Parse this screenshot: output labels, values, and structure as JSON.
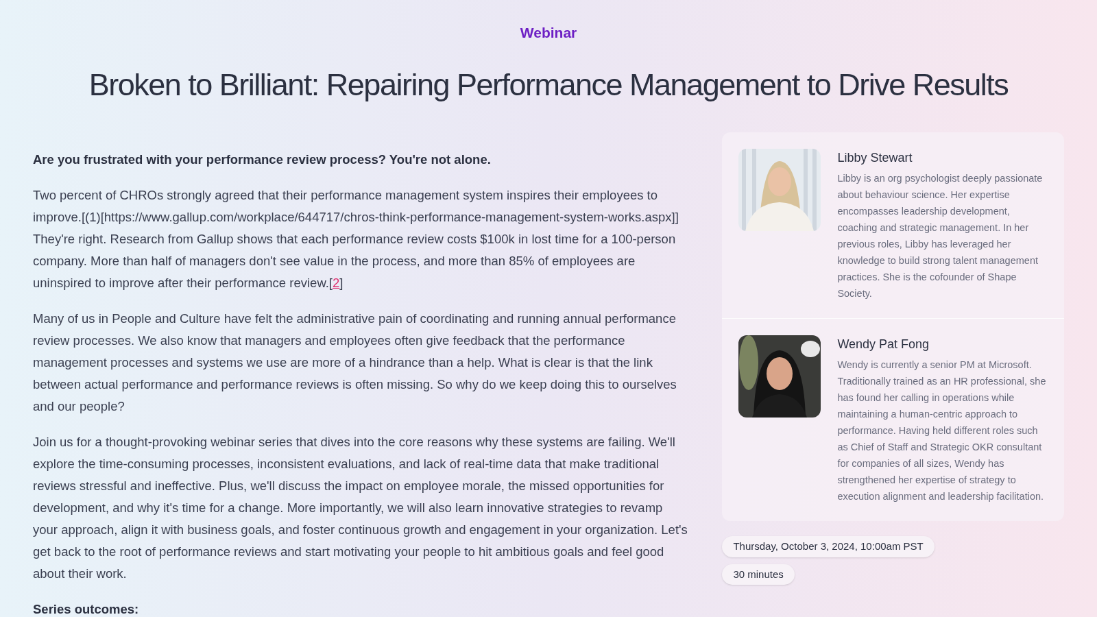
{
  "eyebrow": "Webinar",
  "title": "Broken to Brilliant: Repairing Performance Management to Drive Results",
  "intro": "Are you frustrated with your performance review process? You're not alone.",
  "paragraphs": [
    {
      "text": "Two percent of CHROs strongly agreed that their performance management system inspires their employees to improve.[(1)[https://www.gallup.com/workplace/644717/chros-think-performance-management-system-works.aspx]] They're right. Research from Gallup shows that each performance review costs $100k in lost time for a 100-person company. More than half of managers don't see value in the process, and more than 85% of employees are uninspired to improve after their performance review.[",
      "link": "2",
      "after": "]"
    },
    {
      "text": "Many of us in People and Culture have felt the administrative pain of coordinating and running annual performance review processes. We also know that managers and employees often give feedback that the performance management processes and systems we use are more of a hindrance than a help. What is clear is that the link between actual performance and performance reviews is often missing. So why do we keep doing this to ourselves and our people?"
    },
    {
      "text": "Join us for a thought-provoking webinar series that dives into the core reasons why these systems are failing. We'll explore the time-consuming processes, inconsistent evaluations, and lack of real-time data that make traditional reviews stressful and ineffective. Plus, we'll discuss the impact on employee morale, the missed opportunities for development, and why it's time for a change. More importantly, we will also learn innovative strategies to revamp your approach, align it with business goals, and foster continuous growth and engagement in your organization. Let's get back to the root of performance reviews and start motivating your people to hit ambitious goals and feel good about their work."
    }
  ],
  "section_heading": "Series outcomes:",
  "speakers": [
    {
      "name": "Libby Stewart",
      "bio": "Libby is an org psychologist deeply passionate about behaviour science. Her expertise encompasses leadership development, coaching and strategic management. In her previous roles, Libby has leveraged her knowledge to build strong talent management practices. She is the cofounder of Shape Society."
    },
    {
      "name": "Wendy Pat Fong",
      "bio": "Wendy is currently a senior PM at Microsoft. Traditionally trained as an HR professional, she has found her calling in operations while maintaining a human-centric approach to performance. Having held different roles such as Chief of Staff and Strategic OKR consultant for companies of all sizes, Wendy has strengthened her expertise of strategy to execution alignment and leadership facilitation."
    }
  ],
  "details": [
    "Thursday, October 3, 2024, 10:00am PST",
    "30 minutes"
  ]
}
